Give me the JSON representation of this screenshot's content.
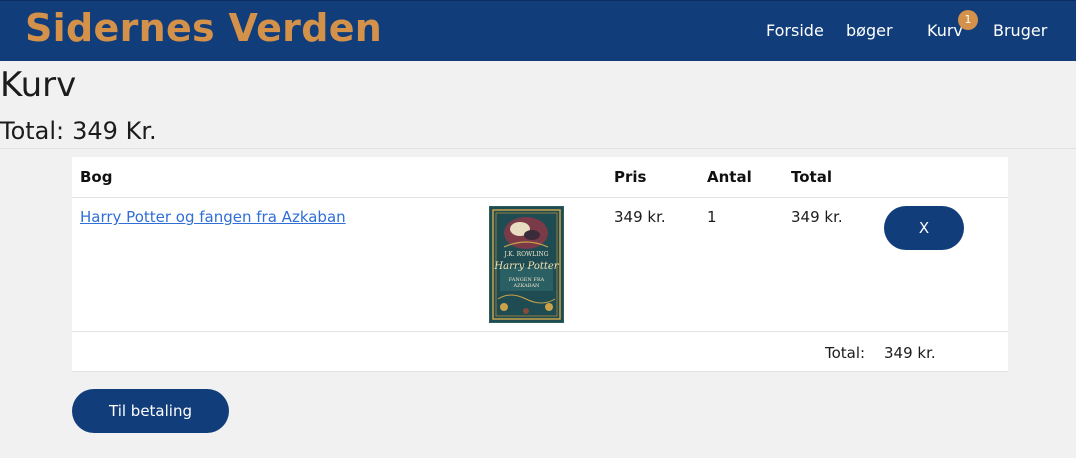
{
  "site": {
    "brand": "Sidernes Verden",
    "nav": {
      "forside": "Forside",
      "boger": "bøger",
      "kurv": "Kurv",
      "bruger": "Bruger"
    },
    "cart_count": "1"
  },
  "page": {
    "title": "Kurv",
    "total_label": "Total:",
    "total_value": "349 Kr."
  },
  "table": {
    "headers": {
      "bog": "Bog",
      "pris": "Pris",
      "antal": "Antal",
      "total": "Total"
    },
    "rows": [
      {
        "title": "Harry Potter og fangen fra Azkaban",
        "cover_author": "J.K. ROWLING",
        "cover_title": "Harry Potter",
        "cover_subtitle": "FANGEN FRA AZKABAN",
        "price": "349 kr.",
        "quantity": "1",
        "total": "349 kr.",
        "remove_label": "X"
      }
    ],
    "footer": {
      "total_label": "Total:",
      "total_value": "349 kr."
    }
  },
  "actions": {
    "checkout_label": "Til betaling"
  },
  "colors": {
    "navbar": "#113e7a",
    "brand": "#d4914a",
    "badge": "#d4914a",
    "link": "#2f6fd6",
    "button": "#113e7a",
    "background": "#f1f1f1"
  },
  "icons": {
    "cart_badge": "cart-count-badge"
  }
}
